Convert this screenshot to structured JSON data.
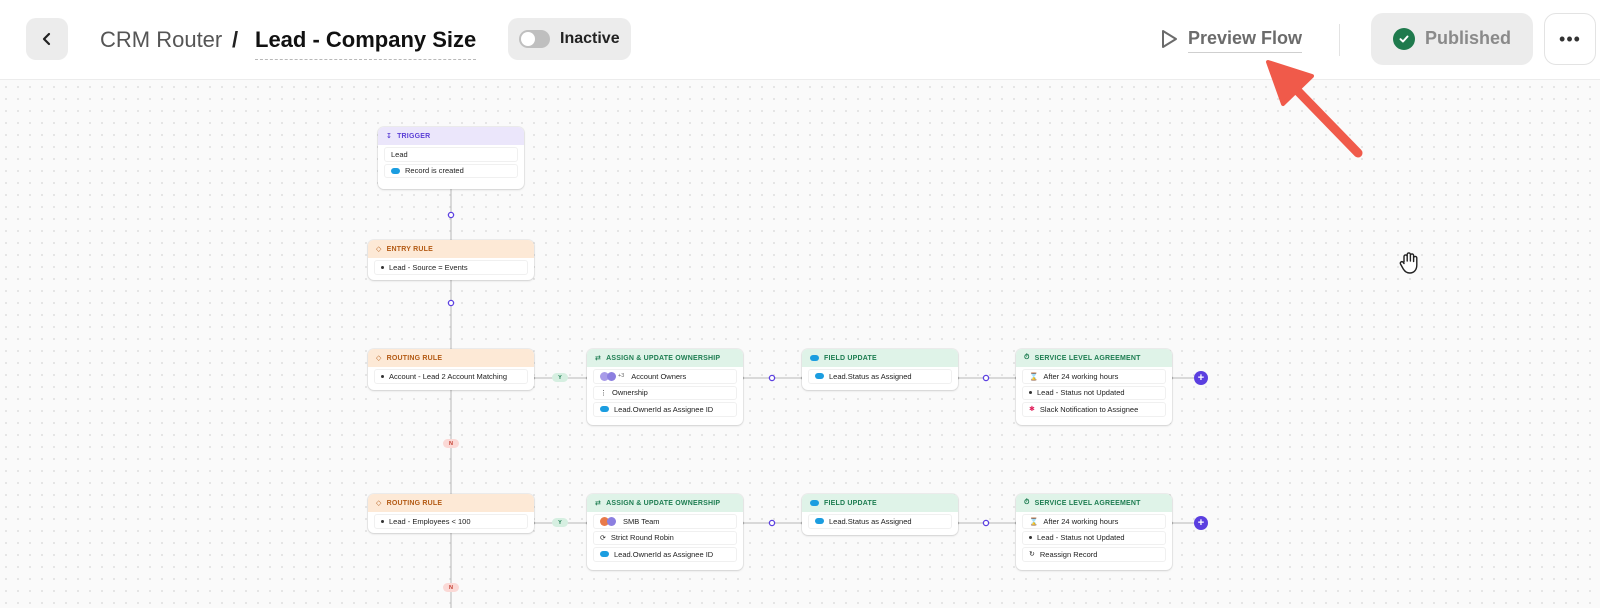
{
  "header": {
    "breadcrumb_root": "CRM Router",
    "breadcrumb_sep": "/",
    "breadcrumb_current": "Lead - Company Size",
    "status_label": "Inactive",
    "preview_label": "Preview Flow",
    "published_label": "Published",
    "more_label": "•••"
  },
  "colors": {
    "accent": "#5b3fe0",
    "published_check": "#1f7a4d",
    "annotation_arrow": "#f05a4a"
  },
  "icons": [
    "back-icon",
    "play-icon",
    "check-icon",
    "more-icon",
    "hand-cursor-icon"
  ],
  "flow": {
    "trigger": {
      "title": "TRIGGER",
      "rows": [
        "Lead",
        "Record is created"
      ]
    },
    "entry_rule": {
      "title": "ENTRY RULE",
      "rows": [
        "Lead - Source = Events"
      ]
    },
    "branches": [
      {
        "routing_rule": {
          "title": "ROUTING RULE",
          "condition": "Account - Lead 2 Account Matching"
        },
        "yes_label": "Y",
        "no_label": "N",
        "assign": {
          "title": "ASSIGN & UPDATE OWNERSHIP",
          "rows": [
            "Account Owners",
            "Ownership",
            "Lead.OwnerId as Assignee ID"
          ],
          "avatar_extra": "+3"
        },
        "field_update": {
          "title": "FIELD UPDATE",
          "rows": [
            "Lead.Status as Assigned"
          ]
        },
        "sla": {
          "title": "SERVICE LEVEL AGREEMENT",
          "rows": [
            "After 24 working hours",
            "Lead - Status not Updated",
            "Slack Notification to Assignee"
          ]
        },
        "add_label": "+"
      },
      {
        "routing_rule": {
          "title": "ROUTING RULE",
          "condition": "Lead - Employees < 100"
        },
        "yes_label": "Y",
        "no_label": "N",
        "assign": {
          "title": "ASSIGN & UPDATE OWNERSHIP",
          "rows": [
            "SMB Team",
            "Strict Round Robin",
            "Lead.OwnerId as Assignee ID"
          ]
        },
        "field_update": {
          "title": "FIELD UPDATE",
          "rows": [
            "Lead.Status as Assigned"
          ]
        },
        "sla": {
          "title": "SERVICE LEVEL AGREEMENT",
          "rows": [
            "After 24 working hours",
            "Lead - Status not Updated",
            "Reassign Record"
          ]
        },
        "add_label": "+"
      }
    ]
  }
}
